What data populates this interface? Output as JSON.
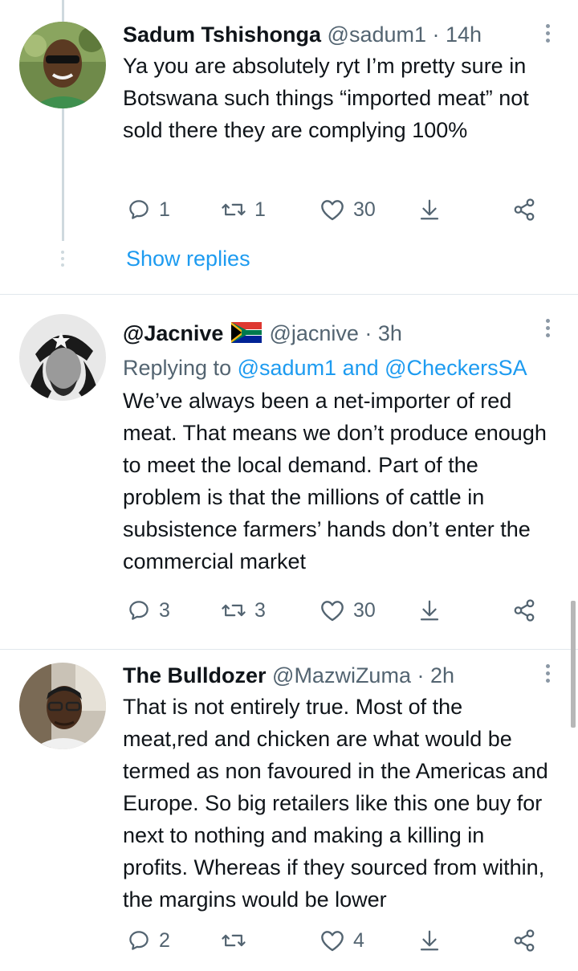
{
  "tweets": [
    {
      "name": "Sadum Tshishonga",
      "handle": "@sadum1",
      "time": "· 14h",
      "replying_prefix": "",
      "replying_to": "",
      "text": "Ya you are absolutely ryt I’m pretty sure in Botswana such things “imported meat” not sold there they are complying 100%",
      "replies": "1",
      "retweets": "1",
      "likes": "30",
      "show_replies": "Show replies"
    },
    {
      "name": "@Jacnive",
      "flag": "south-africa-flag-icon",
      "handle": "@jacnive",
      "time": "· 3h",
      "replying_prefix": "Replying to",
      "replying_to": "@sadum1 and @CheckersSA",
      "text": "We’ve always been a net-importer of red meat. That means we don’t produce enough to meet the local demand. Part of the problem is that the millions of cattle in subsistence farmers’ hands don’t enter the commercial market",
      "replies": "3",
      "retweets": "3",
      "likes": "30"
    },
    {
      "name": "The Bulldozer",
      "handle": "@MazwiZuma",
      "time": "· 2h",
      "text": "That is not entirely true. Most of the meat,red and chicken are what would be termed as non favoured in the Americas and Europe. So big retailers like this one buy for next to nothing and making a killing in profits. Whereas if they sourced from within, the margins would be lower",
      "replies": "2",
      "retweets": "",
      "likes": "4"
    }
  ],
  "colors": {
    "text": "#0f1419",
    "secondary": "#536471",
    "link": "#1d9bf0",
    "thread_line": "#cfd9de"
  },
  "icons": [
    "reply-icon",
    "retweet-icon",
    "like-icon",
    "share-icon",
    "more-icon"
  ]
}
